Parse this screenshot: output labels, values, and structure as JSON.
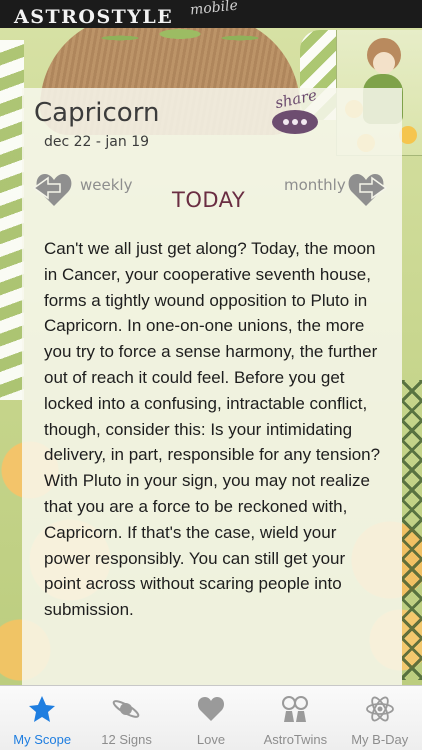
{
  "header": {
    "brand": "ASTROSTYLE",
    "brand_sub": "mobile"
  },
  "sign": {
    "name": "Capricorn",
    "dates": "dec 22 - jan 19"
  },
  "share_label": "share",
  "nav": {
    "prev_label": "weekly",
    "next_label": "monthly",
    "current_label": "TODAY"
  },
  "horoscope_text": "Can't we all just get along? Today, the moon in Cancer, your cooperative seventh house, forms a tightly wound opposition to Pluto in Capricorn. In one-on-one unions, the more you try to force a sense harmony, the further out of reach it could feel. Before you get locked into a confusing, intractable conflict, though, consider this: Is your intimidating delivery, in part, responsible for any tension? With Pluto in your sign, you may not realize that you are a force to be reckoned with, Capricorn. If that's the case, wield your power responsibly. You can still get your point across without scaring people into submission.",
  "tabs": [
    {
      "label": "My Scope",
      "icon": "star-icon",
      "active": true
    },
    {
      "label": "12 Signs",
      "icon": "planet-icon",
      "active": false
    },
    {
      "label": "Love",
      "icon": "heart-icon",
      "active": false
    },
    {
      "label": "AstroTwins",
      "icon": "twins-icon",
      "active": false
    },
    {
      "label": "My B-Day",
      "icon": "atom-icon",
      "active": false
    }
  ],
  "colors": {
    "active_tab": "#1f7ee0",
    "today": "#6a2d42",
    "share": "#6d4d70"
  }
}
